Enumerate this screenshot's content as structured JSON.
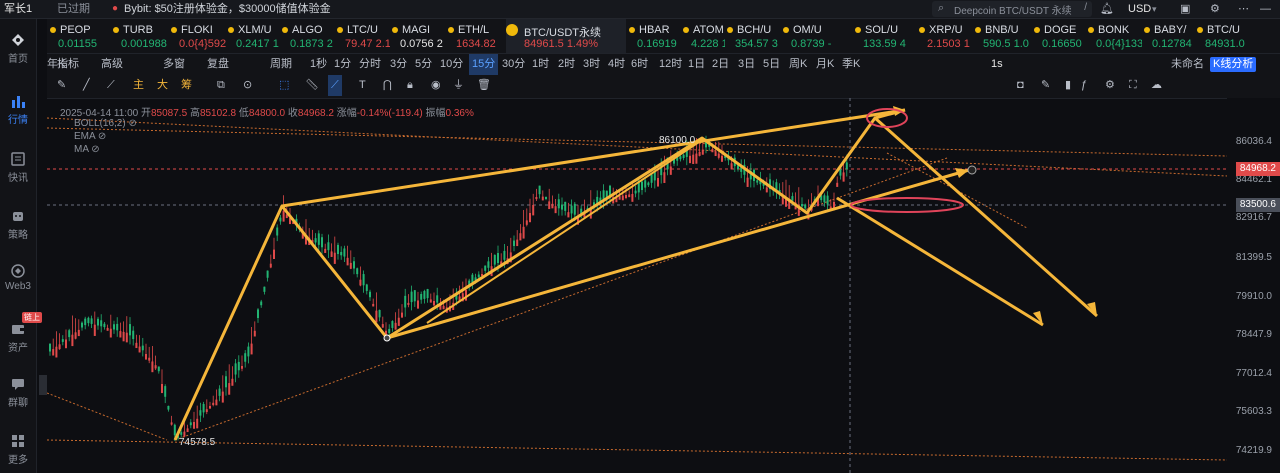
{
  "topbar": {
    "user": "军长1",
    "status": "已过期",
    "ad": "Bybit: $50注册体验金，$30000储值体验金",
    "search_placeholder": "Deepcoin BTC/USDT 永续",
    "search_key": "/",
    "currency": "USD"
  },
  "sidebar": {
    "items": [
      {
        "label": "首页"
      },
      {
        "label": "行情"
      },
      {
        "label": "快讯"
      },
      {
        "label": "策略"
      },
      {
        "label": "Web3"
      },
      {
        "label": "资产",
        "badge": "链上"
      },
      {
        "label": "群聊"
      },
      {
        "label": "更多"
      }
    ]
  },
  "tickers": [
    {
      "name": "PEOP",
      "price": "0.01155",
      "dir": "up"
    },
    {
      "name": "TURB",
      "price": "0.001988",
      "dir": "up"
    },
    {
      "name": "FLOKI",
      "price": "0.0{4}592",
      "dir": "down"
    },
    {
      "name": "XLM/U",
      "price": "0.2417 1",
      "dir": "up"
    },
    {
      "name": "ALGO",
      "price": "0.1873 2",
      "dir": "up"
    },
    {
      "name": "LTC/U",
      "price": "79.47 2.1",
      "dir": "down"
    },
    {
      "name": "MAGI",
      "price": "0.0756 2",
      "dir": "neutral"
    },
    {
      "name": "ETH/L",
      "price": "1634.82",
      "dir": "down"
    },
    {
      "name": "BTC/USDT永续",
      "price": "84961.5 1.49%",
      "dir": "down"
    },
    {
      "name": "HBAR",
      "price": "0.16919",
      "dir": "up"
    },
    {
      "name": "ATOM",
      "price": "4.228 1.9",
      "dir": "up"
    },
    {
      "name": "BCH/U",
      "price": "354.57 3",
      "dir": "up"
    },
    {
      "name": "OM/U",
      "price": "0.8739 -",
      "dir": "up"
    },
    {
      "name": "SOL/U",
      "price": "133.59 4",
      "dir": "up"
    },
    {
      "name": "XRP/U",
      "price": "2.1503 1",
      "dir": "down"
    },
    {
      "name": "BNB/U",
      "price": "590.5 1.0",
      "dir": "up"
    },
    {
      "name": "DOGE",
      "price": "0.16650",
      "dir": "up"
    },
    {
      "name": "BONK",
      "price": "0.0{4}133",
      "dir": "up"
    },
    {
      "name": "BABY/",
      "price": "0.12784",
      "dir": "up"
    },
    {
      "name": "BTC/U",
      "price": "84931.0",
      "dir": "up"
    }
  ],
  "toolbar": {
    "indicators": "指标",
    "advanced": "高级",
    "multi": "多窗",
    "replay": "复盘",
    "period": "周期",
    "intervals": [
      "1秒",
      "1分",
      "分时",
      "3分",
      "5分",
      "10分",
      "15分",
      "30分",
      "1时",
      "2时",
      "3时",
      "4时",
      "6时",
      "12时",
      "1日",
      "2日",
      "3日",
      "5日",
      "周K",
      "月K",
      "季K",
      "年K"
    ],
    "active_interval": "15分",
    "right_interval": "1s",
    "unnamed": "未命名",
    "kline_analysis": "K线分析",
    "quick": [
      "主",
      "大",
      "筹"
    ]
  },
  "legend": {
    "date": "2025-04-14 11:00",
    "open_label": "开",
    "open": "85087.5",
    "high_label": "高",
    "high": "85102.8",
    "low_label": "低",
    "low": "84800.0",
    "close_label": "收",
    "close": "84968.2",
    "change_label": "涨幅",
    "change": "-0.14%(-119.4)",
    "amp_label": "振幅",
    "amp": "0.36%",
    "indicators": [
      "BOLL(16,2)",
      "EMA",
      "MA"
    ]
  },
  "price_axis": {
    "labels": [
      "86036.4",
      "84462.1",
      "82916.7",
      "81399.5",
      "79910.0",
      "78447.9",
      "77012.4",
      "75603.3",
      "74219.9"
    ],
    "current_price": "84968.2",
    "crosshair_price": "83500.6"
  },
  "annotations": {
    "high": "86100.0",
    "low": "74578.5"
  },
  "colors": {
    "up": "#22b573",
    "down": "#e04a4a",
    "accent": "#3b82f6",
    "drawing": "#f5b63a",
    "ellipse": "#e0445a"
  }
}
